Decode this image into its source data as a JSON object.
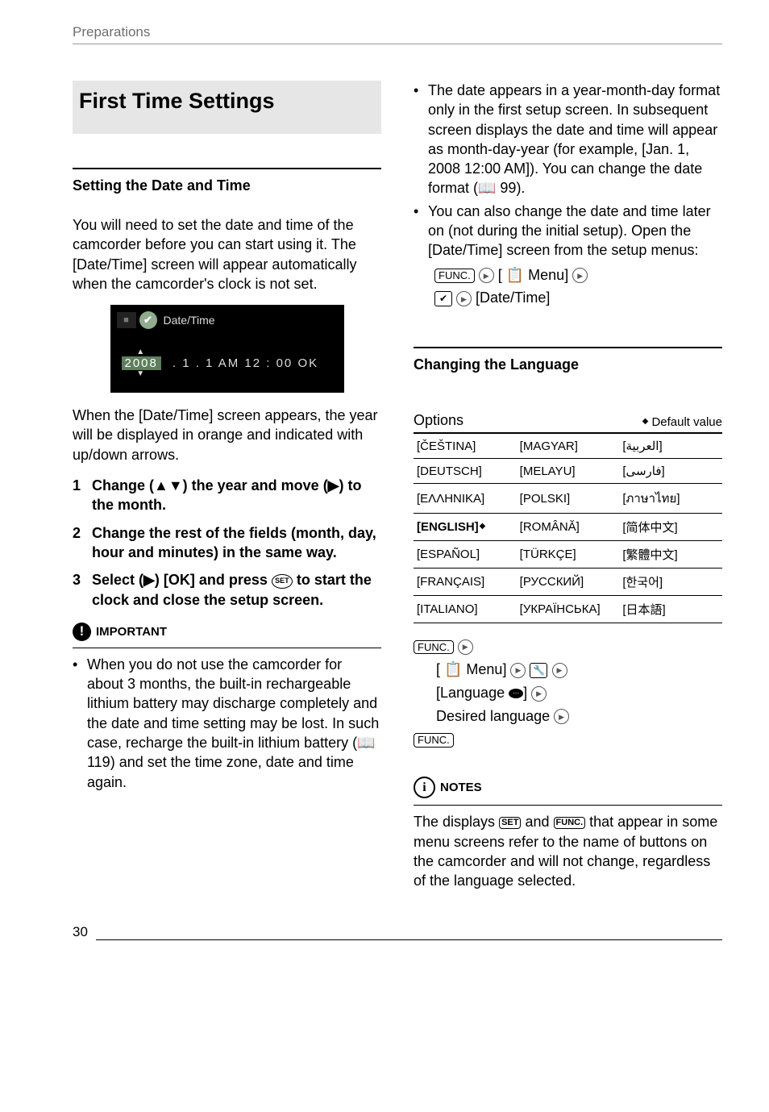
{
  "header": "Preparations",
  "page_number": "30",
  "left": {
    "big_title": "First Time Settings",
    "sub1_title": "Setting the Date and Time",
    "intro": "You will need to set the date and time of the camcorder before you can start using it. The [Date/Time] screen will appear automatically when the camcorder's clock is not set.",
    "lcd": {
      "title": "Date/Time",
      "year": "2008",
      "rest": ".  1 .  1  AM  12 : 00  OK"
    },
    "after_lcd": "When the [Date/Time] screen appears, the year will be displayed in orange and indicated with up/down arrows.",
    "steps": [
      "Change (▲▼) the year and move (▶) to the month.",
      "Change the rest of the fields (month, day, hour and minutes) in the same way.",
      "Select (▶) [OK] and press  to start the clock and close the setup screen."
    ],
    "set_label": "SET",
    "important_label": "IMPORTANT",
    "important_bullets": [
      "When you do not use the camcorder for about 3 months, the built-in rechargeable lithium battery may discharge completely and the date and time setting may be lost. In such case, recharge the built-in lithium battery (📖 119) and set the time zone, date and time again."
    ]
  },
  "right": {
    "top_bullets": [
      "The date appears in a year-month-day format only in the first setup screen. In subsequent screen displays the date and time will appear as month-day-year (for example, [Jan. 1, 2008 12:00 AM]). You can change the date format (📖 99).",
      "You can also change the date and time later on (not during the initial setup). Open the [Date/Time] screen from the setup menus:"
    ],
    "path_line1_pill": "FUNC.",
    "path_line1_mid": "[ 📋 Menu]",
    "path_line2_mid": "[Date/Time]",
    "sub2_title": "Changing the Language",
    "options_label": "Options",
    "default_label": "Default value",
    "lang_table": [
      [
        "[ČEŠTINA]",
        "[MAGYAR]",
        "[العربية]"
      ],
      [
        "[DEUTSCH]",
        "[MELAYU]",
        "[فارسی]"
      ],
      [
        "[ΕΛΛΗΝΙΚΑ]",
        "[POLSKI]",
        "[ภาษาไทย]"
      ],
      [
        "[ENGLISH]",
        "[ROMÂNĂ]",
        "[简体中文]"
      ],
      [
        "[ESPAÑOL]",
        "[TÜRKÇE]",
        "[繁體中文]"
      ],
      [
        "[FRANÇAIS]",
        "[РУССКИЙ]",
        "[한국어]"
      ],
      [
        "[ITALIANO]",
        "[УКРАЇНСЬКА]",
        "[日本語]"
      ]
    ],
    "default_row_index": 3,
    "seq": {
      "func": "FUNC.",
      "line1": "[ 📋 Menu]",
      "line2": "[Language ",
      "line2_suffix": "]",
      "line3": "Desired language",
      "end": "FUNC."
    },
    "notes_label": "NOTES",
    "notes_set": "SET",
    "notes_func": "FUNC.",
    "notes_text_pre": "The displays ",
    "notes_text_mid": " and ",
    "notes_text_post": " that appear in some menu screens refer to the name of buttons on the camcorder and will not change, regardless of the language selected."
  }
}
